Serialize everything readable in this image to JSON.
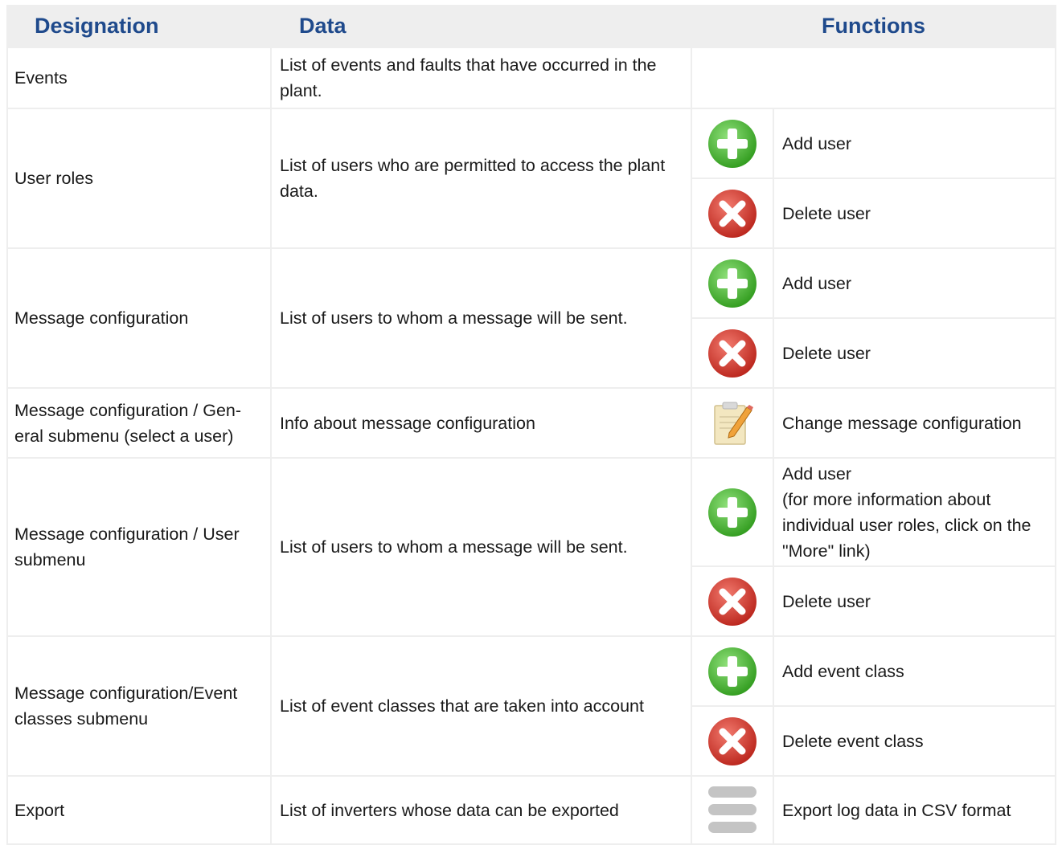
{
  "header": {
    "designation": "Designation",
    "data": "Data",
    "functions": "Functions"
  },
  "rows": [
    {
      "designation": "Events",
      "data": "List of events and faults that have occurred in the plant.",
      "functions": []
    },
    {
      "designation": "User roles",
      "data": "List of users who are permitted to access the plant data.",
      "functions": [
        {
          "icon": "add-icon",
          "label": "Add user"
        },
        {
          "icon": "delete-icon",
          "label": "Delete user"
        }
      ]
    },
    {
      "designation": "Message configuration",
      "data": "List of users to whom a message will be sent.",
      "functions": [
        {
          "icon": "add-icon",
          "label": "Add user"
        },
        {
          "icon": "delete-icon",
          "label": "Delete user"
        }
      ]
    },
    {
      "designation": "Message configuration / Gen-eral submenu (select a user)",
      "data": "Info about message configuration",
      "functions": [
        {
          "icon": "edit-note-icon",
          "label": "Change message configuration"
        }
      ]
    },
    {
      "designation": "Message configuration / User submenu",
      "data": "List of users to whom a message will be sent.",
      "functions": [
        {
          "icon": "add-icon",
          "label": "Add user\n(for more information about individual user roles, click on the \"More\" link)"
        },
        {
          "icon": "delete-icon",
          "label": "Delete user"
        }
      ]
    },
    {
      "designation": "Message configuration/Event classes submenu",
      "data": "List of event classes that are taken into account",
      "functions": [
        {
          "icon": "add-icon",
          "label": "Add event class"
        },
        {
          "icon": "delete-icon",
          "label": "Delete event class"
        }
      ]
    },
    {
      "designation": "Export",
      "data": "List of inverters whose data can be exported",
      "functions": [
        {
          "icon": "export-icon",
          "label": "Export log data in CSV format"
        }
      ]
    }
  ],
  "colors": {
    "header_text": "#1f4a8c",
    "header_bg": "#eeeeee",
    "grid": "#eeeeee",
    "add_icon": "#4caf2c",
    "delete_icon": "#d9362b",
    "export_icon": "#c4c4c4"
  }
}
